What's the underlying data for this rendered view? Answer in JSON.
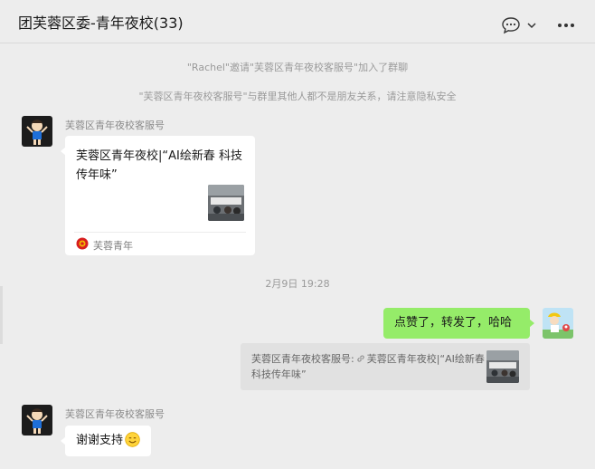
{
  "header": {
    "title": "团芙蓉区委-青年夜校(33)",
    "icons": [
      "chat-bubble-icon",
      "chevron-down-icon",
      "more-icon"
    ]
  },
  "system_messages": [
    "\"Rachel\"邀请\"芙蓉区青年夜校客服号\"加入了群聊",
    "\"芙蓉区青年夜校客服号\"与群里其他人都不是朋友关系，请注意隐私安全"
  ],
  "messages": [
    {
      "type": "article-card",
      "sender": "芙蓉区青年夜校客服号",
      "title": "芙蓉区青年夜校|“AI绘新春 科技传年味”",
      "source": "芙蓉青年"
    },
    {
      "type": "timestamp",
      "text": "2月9日 19:28"
    },
    {
      "type": "outgoing",
      "text": "点赞了，转发了，哈哈",
      "quote_prefix": "芙蓉区青年夜校客服号:",
      "quote_body": "芙蓉区青年夜校|“AI绘新春 科技传年味”"
    },
    {
      "type": "incoming",
      "sender": "芙蓉区青年夜校客服号",
      "text": "谢谢支持"
    }
  ],
  "colors": {
    "background": "#ededed",
    "outgoing_bubble": "#95ec69",
    "incoming_bubble": "#ffffff",
    "quote_background": "#e1e1e1"
  }
}
